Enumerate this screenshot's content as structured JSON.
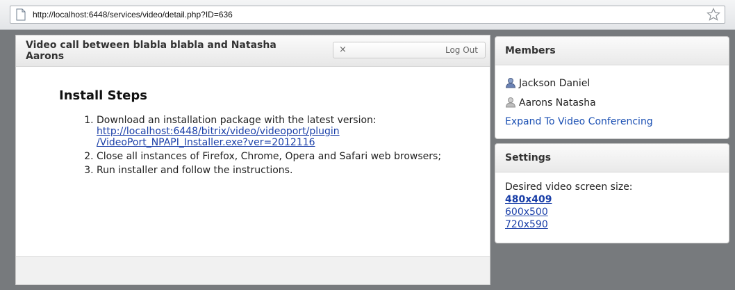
{
  "browser": {
    "url": "http://localhost:6448/services/video/detail.php?ID=636"
  },
  "call": {
    "title": "Video call between blabla blabla and Natasha Aarons",
    "close_glyph": "×",
    "logout_label": "Log Out"
  },
  "install": {
    "heading": "Install Steps",
    "steps": {
      "step1_text": "Download an installation package with the latest version:",
      "step1_link": "http://localhost:6448/bitrix/video/videoport/plugin/VideoPort_NPAPI_Installer.exe?ver=2012116",
      "step1_link_line1": "http://localhost:6448/bitrix/video/videoport/plugin",
      "step1_link_line2": "/VideoPort_NPAPI_Installer.exe?ver=2012116",
      "step2_text": "Close all instances of Firefox, Chrome, Opera and Safari web browsers;",
      "step3_text": "Run installer and follow the instructions."
    }
  },
  "members": {
    "header": "Members",
    "items": [
      "Jackson Daniel",
      "Aarons Natasha"
    ],
    "expand_label": "Expand To Video Conferencing"
  },
  "settings": {
    "header": "Settings",
    "label": "Desired video screen size:",
    "sizes": [
      "480x409",
      "600x500",
      "720x590"
    ],
    "selected": "480x409"
  },
  "icons": {
    "page": "page-icon",
    "star": "star-icon",
    "close": "close-icon",
    "user": "user-icon"
  }
}
